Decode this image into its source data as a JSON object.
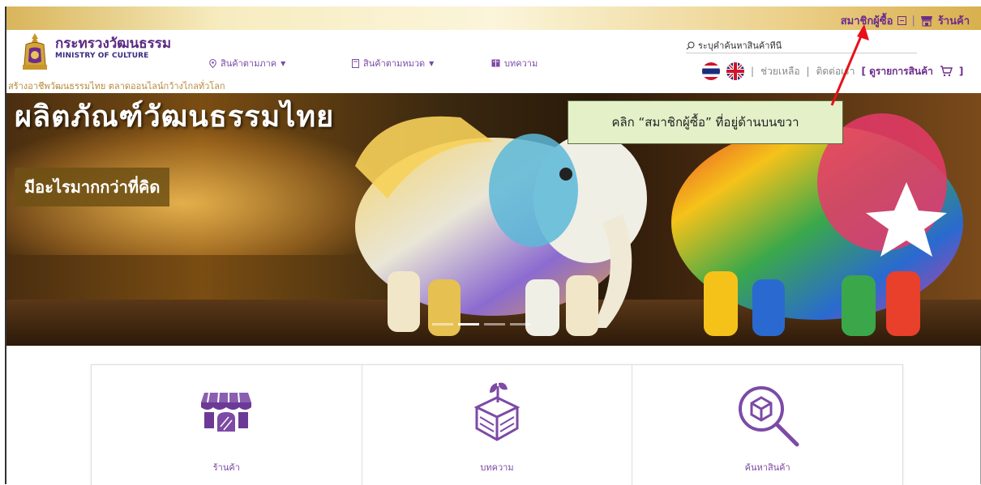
{
  "topbar": {
    "member_label": "สมาชิกผู้ซื้อ",
    "separator": "|",
    "shop_label": "ร้านค้า"
  },
  "header": {
    "brand_th": "กระทรวงวัฒนธรรม",
    "brand_en": "MINISTRY OF CULTURE",
    "slogan": "สร้างอาชีพวัฒนธรรมไทย ตลาดออนไลน์กว้างไกลทั่วโลก",
    "nav": [
      {
        "label": "สินค้าตามภาค",
        "icon": "location-pin-icon"
      },
      {
        "label": "สินค้าตามหมวด",
        "icon": "document-icon"
      },
      {
        "label": "บทความ",
        "icon": "book-icon"
      }
    ],
    "search_placeholder": "ระบุคำค้นหาสินค้าที่นี่",
    "help_label": "ช่วยเหลือ",
    "contact_label": "ติดต่อเรา",
    "cart_label": "[ ดูรายการสินค้า",
    "cart_close": "]",
    "divider": "|"
  },
  "hero": {
    "title": "ผลิตภัณฑ์วัฒนธรรมไทย",
    "subtitle": "มีอะไรมากกว่าที่คิด",
    "slides": 4,
    "active_slide": 2
  },
  "callout": {
    "text": "คลิก “สมาชิกผู้ซื้อ” ที่อยู่ด้านบนขวา"
  },
  "cards": [
    {
      "label": "ร้านค้า",
      "icon": "storefront-icon"
    },
    {
      "label": "บทความ",
      "icon": "box-plant-icon"
    },
    {
      "label": "ค้นหาสินค้า",
      "icon": "search-box-icon"
    }
  ],
  "colors": {
    "brand_purple": "#6c2b8a",
    "nav_purple": "#7d4aa6",
    "gold": "#b8893a",
    "callout_bg": "#e3f0c8",
    "arrow_red": "#e8101a"
  }
}
